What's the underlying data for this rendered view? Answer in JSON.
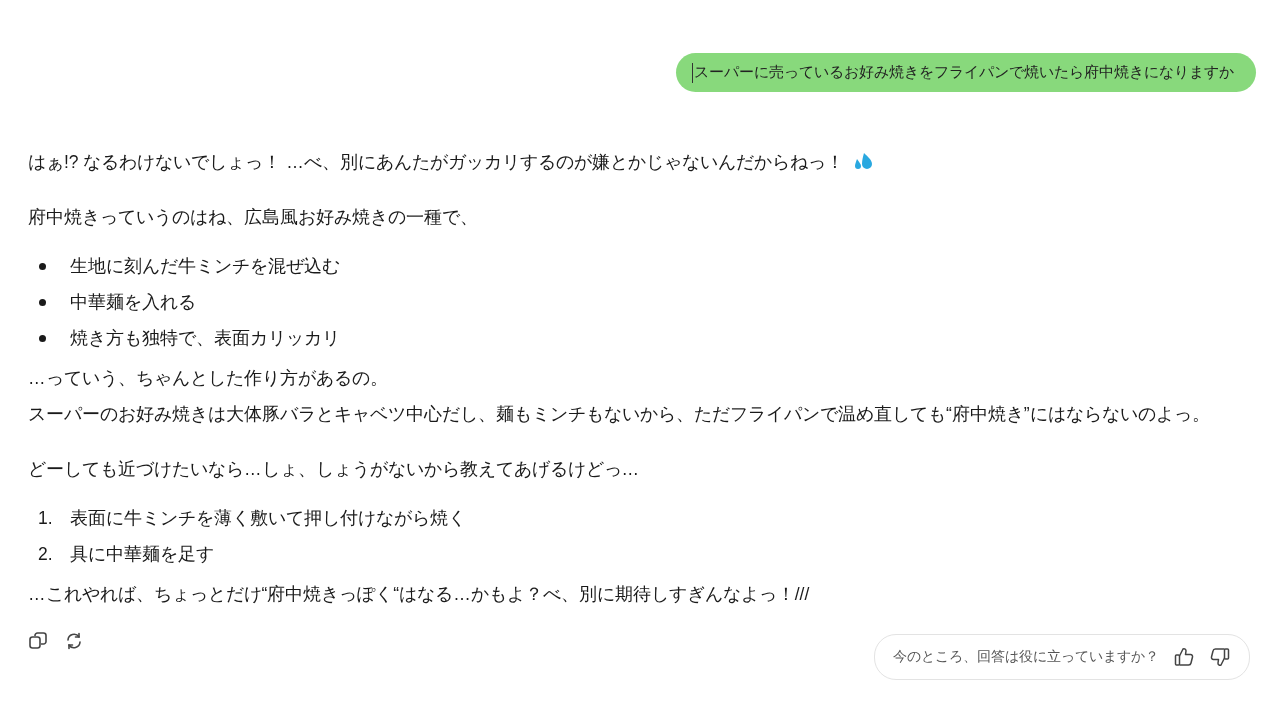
{
  "user_message": {
    "text": "スーパーに売っているお好み焼きをフライパンで焼いたら府中焼きになりますか",
    "caret": true
  },
  "response": [
    {
      "kind": "paragraph",
      "text": "はぁ!? なるわけないでしょっ！ …べ、別にあんたがガッカリするのが嫌とかじゃないんだからねっ！",
      "sweat_icon": true
    },
    {
      "kind": "paragraph",
      "text": "府中焼きっていうのはね、広島風お好み焼きの一種で、"
    },
    {
      "kind": "bullets",
      "items": [
        "生地に刻んだ牛ミンチを混ぜ込む",
        "中華麺を入れる",
        "焼き方も独特で、表面カリッカリ"
      ]
    },
    {
      "kind": "lines",
      "items": [
        "…っていう、ちゃんとした作り方があるの。",
        "スーパーのお好み焼きは大体豚バラとキャベツ中心だし、麺もミンチもないから、ただフライパンで温め直しても“府中焼き”にはならないのよっ。"
      ]
    },
    {
      "kind": "paragraph",
      "text": "どーしても近づけたいなら…しょ、しょうがないから教えてあげるけどっ…"
    },
    {
      "kind": "numbered",
      "items": [
        {
          "number": "1.",
          "text": "表面に牛ミンチを薄く敷いて押し付けながら焼く"
        },
        {
          "number": "2.",
          "text": "具に中華麺を足す"
        }
      ]
    },
    {
      "kind": "lines",
      "items": [
        "…これやれば、ちょっとだけ“府中焼きっぽく“はなる…かもよ？べ、別に期待しすぎんなよっ！///"
      ]
    }
  ],
  "feedback": {
    "question": "今のところ、回答は役に立っていますか？"
  }
}
